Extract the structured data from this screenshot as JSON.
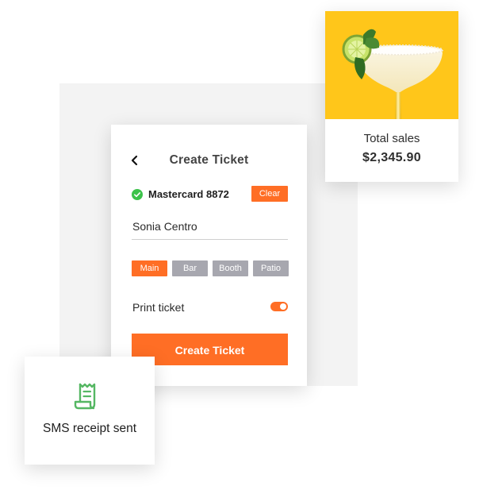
{
  "ticket": {
    "title": "Create Ticket",
    "card_label": "Mastercard 8872",
    "clear_label": "Clear",
    "customer_name": "Sonia Centro",
    "areas": [
      {
        "label": "Main",
        "selected": true
      },
      {
        "label": "Bar",
        "selected": false
      },
      {
        "label": "Booth",
        "selected": false
      },
      {
        "label": "Patio",
        "selected": false
      }
    ],
    "print_label": "Print ticket",
    "print_enabled": true,
    "submit_label": "Create Ticket"
  },
  "sales": {
    "label": "Total sales",
    "value": "$2,345.90",
    "image_icon": "margarita-glass"
  },
  "sms": {
    "label": "SMS receipt sent",
    "icon": "receipt-icon"
  },
  "colors": {
    "accent": "#ff6e25",
    "success": "#3cc24a",
    "tag_inactive": "#a7a7af",
    "sales_bg": "#ffc61a",
    "receipt_icon": "#55b763"
  }
}
